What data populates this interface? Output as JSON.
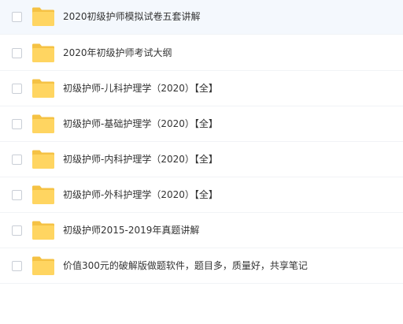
{
  "files": [
    {
      "name": "2020初级护师模拟试卷五套讲解",
      "type": "folder",
      "selected": false
    },
    {
      "name": "2020年初级护师考试大纲",
      "type": "folder",
      "selected": false
    },
    {
      "name": "初级护师-儿科护理学（2020）【全】",
      "type": "folder",
      "selected": false
    },
    {
      "name": "初级护师-基础护理学（2020）【全】",
      "type": "folder",
      "selected": false
    },
    {
      "name": "初级护师-内科护理学（2020）【全】",
      "type": "folder",
      "selected": false
    },
    {
      "name": "初级护师-外科护理学（2020）【全】",
      "type": "folder",
      "selected": false
    },
    {
      "name": "初级护师2015-2019年真题讲解",
      "type": "folder",
      "selected": false
    },
    {
      "name": "价值300元的破解版做题软件，题目多，质量好，共享笔记",
      "type": "folder",
      "selected": false
    }
  ],
  "icons": {
    "folder": "folder-icon",
    "checkbox": "checkbox"
  },
  "colors": {
    "folder_body": "#ffd561",
    "folder_back": "#f5c244",
    "hover_row": "#f4f8fd",
    "text": "#333333",
    "divider": "#f1f3f6"
  }
}
